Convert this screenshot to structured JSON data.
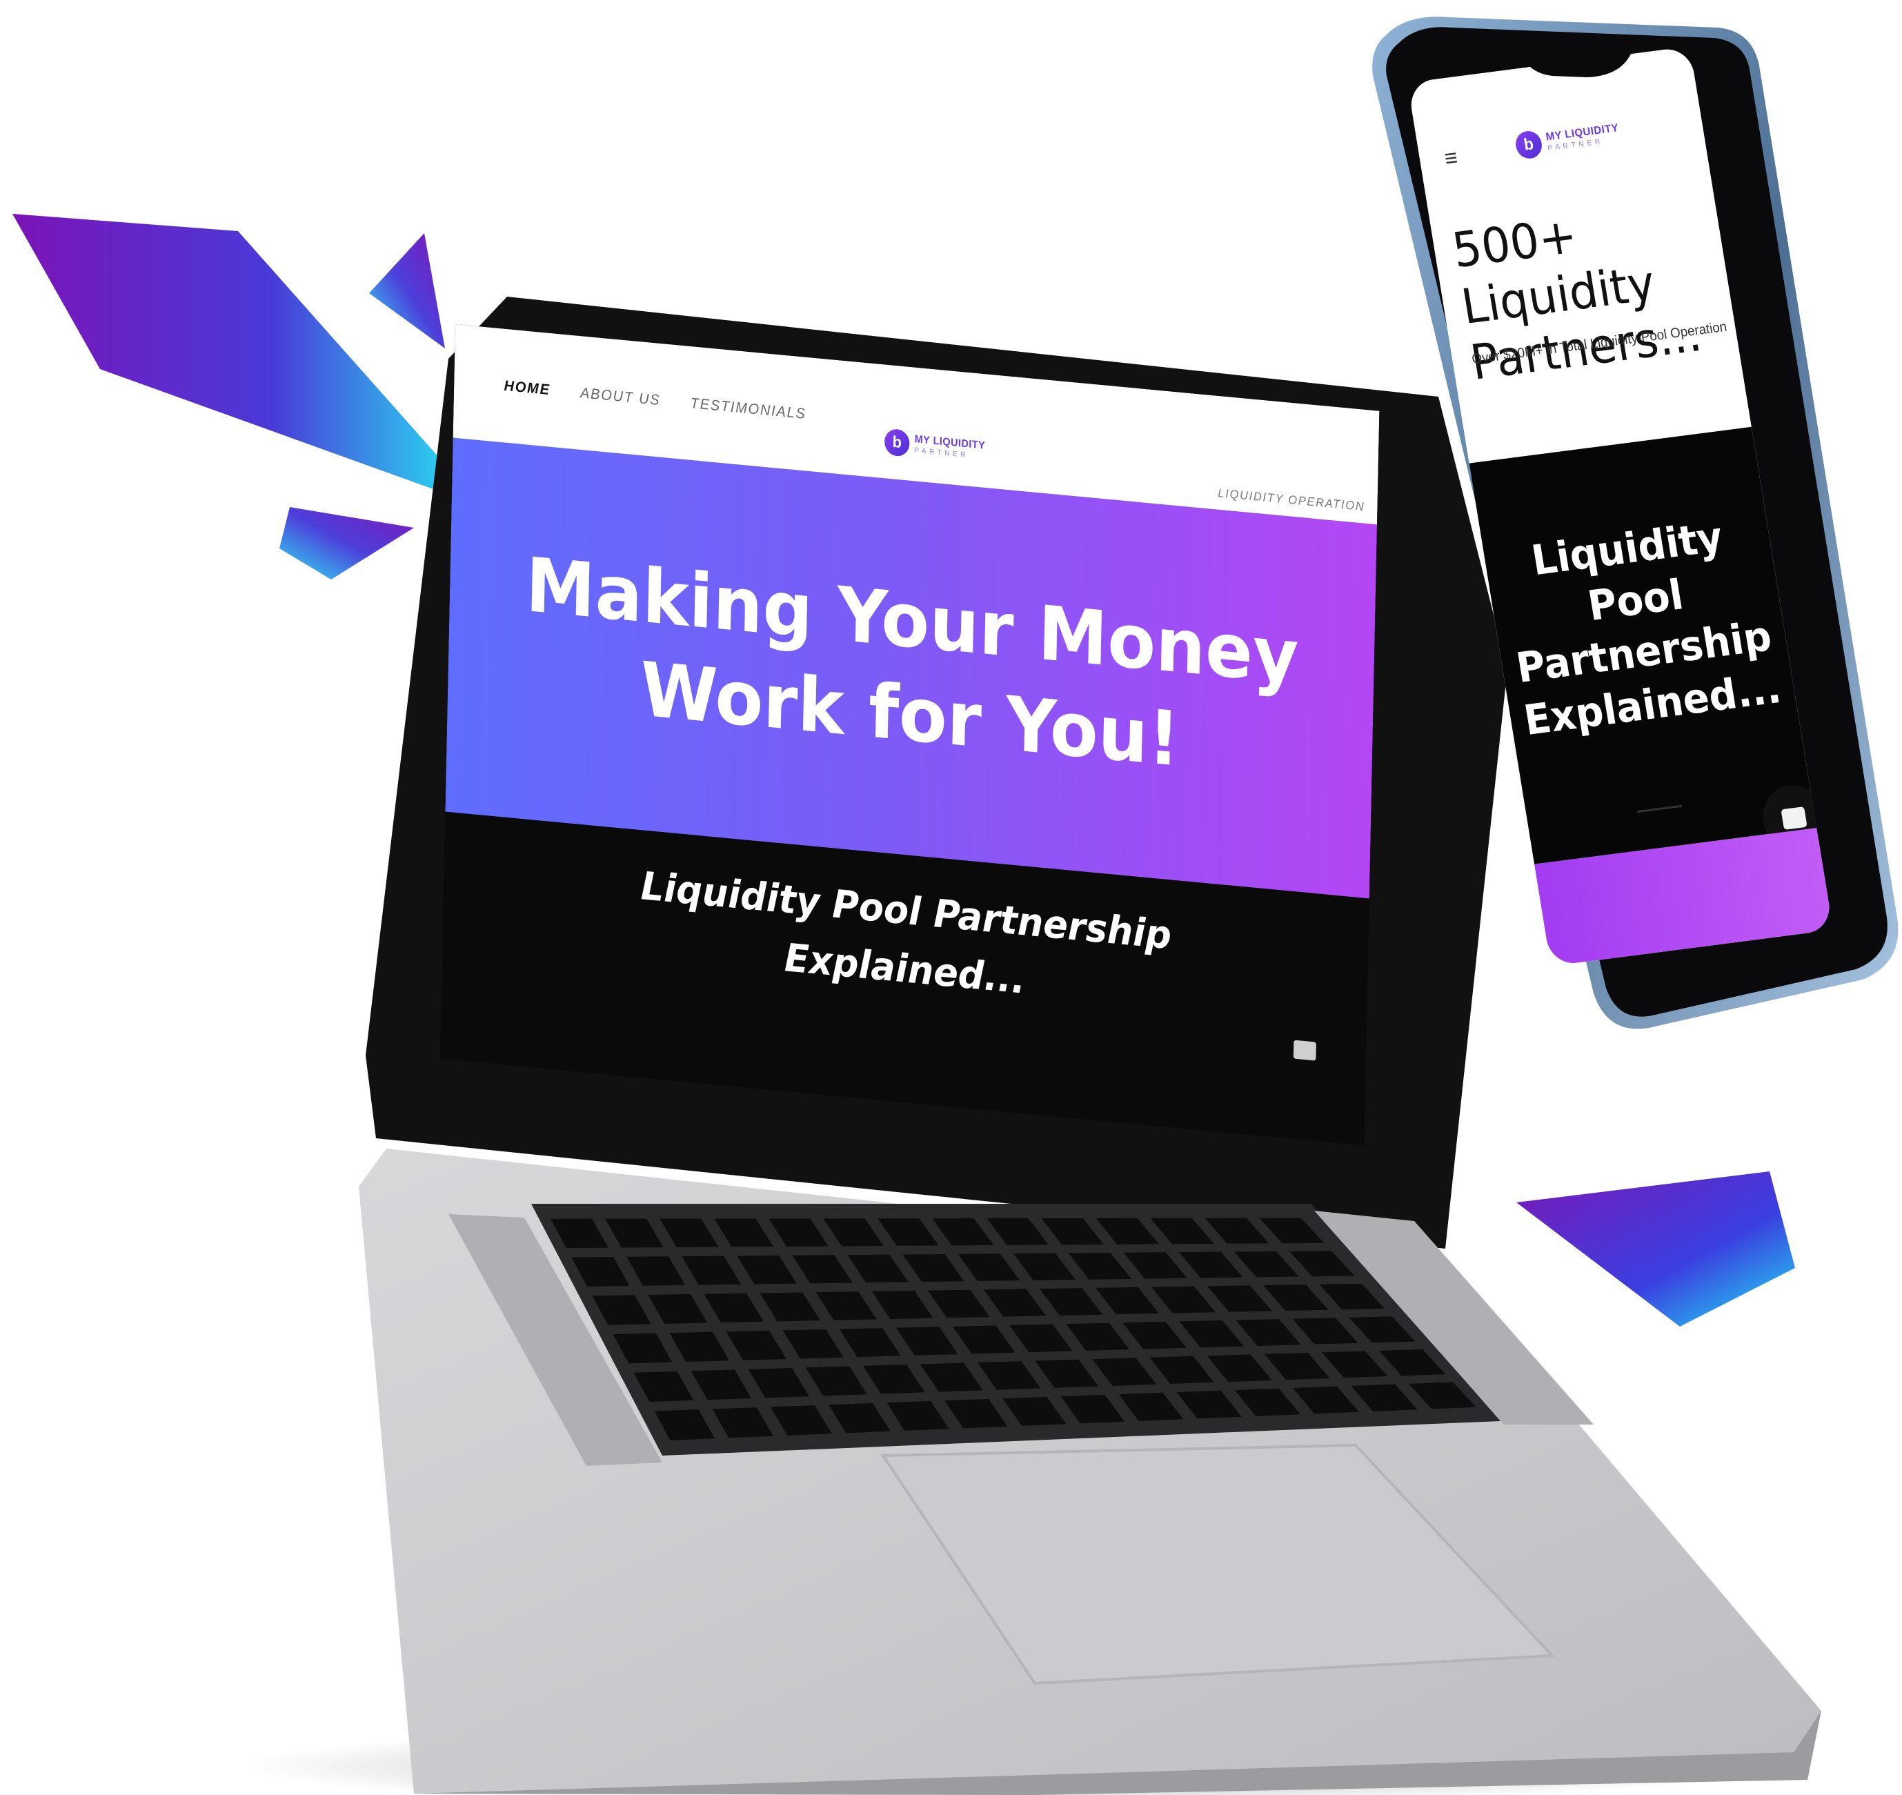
{
  "laptop": {
    "nav": {
      "links": [
        "HOME",
        "ABOUT US",
        "TESTIMONIALS"
      ],
      "right_link": "LIQUIDITY OPERATION"
    },
    "logo": {
      "line1": "MY LIQUIDITY",
      "line2": "PARTNER",
      "mark": "b"
    },
    "hero_title": "Making Your Money Work for You!",
    "subheading": "Liquidity Pool Partnership Explained..."
  },
  "phone": {
    "menu_icon": "≡",
    "logo": {
      "line1": "MY LIQUIDITY",
      "line2": "PARTNER",
      "mark": "b"
    },
    "title": "500+ Liquidity Partners...",
    "subtitle": "Over $20M+ in Total Liquidity Pool Operation",
    "dark_title": "Liquidity Pool Partnership Explained..."
  },
  "colors": {
    "brand_purple": "#7b5cf6",
    "hero_start": "#5f6dff",
    "hero_end": "#b446f5",
    "shard_cyan": "#2ee6f5"
  },
  "icons": [
    "hamburger-icon",
    "chat-icon",
    "logo-icon"
  ]
}
